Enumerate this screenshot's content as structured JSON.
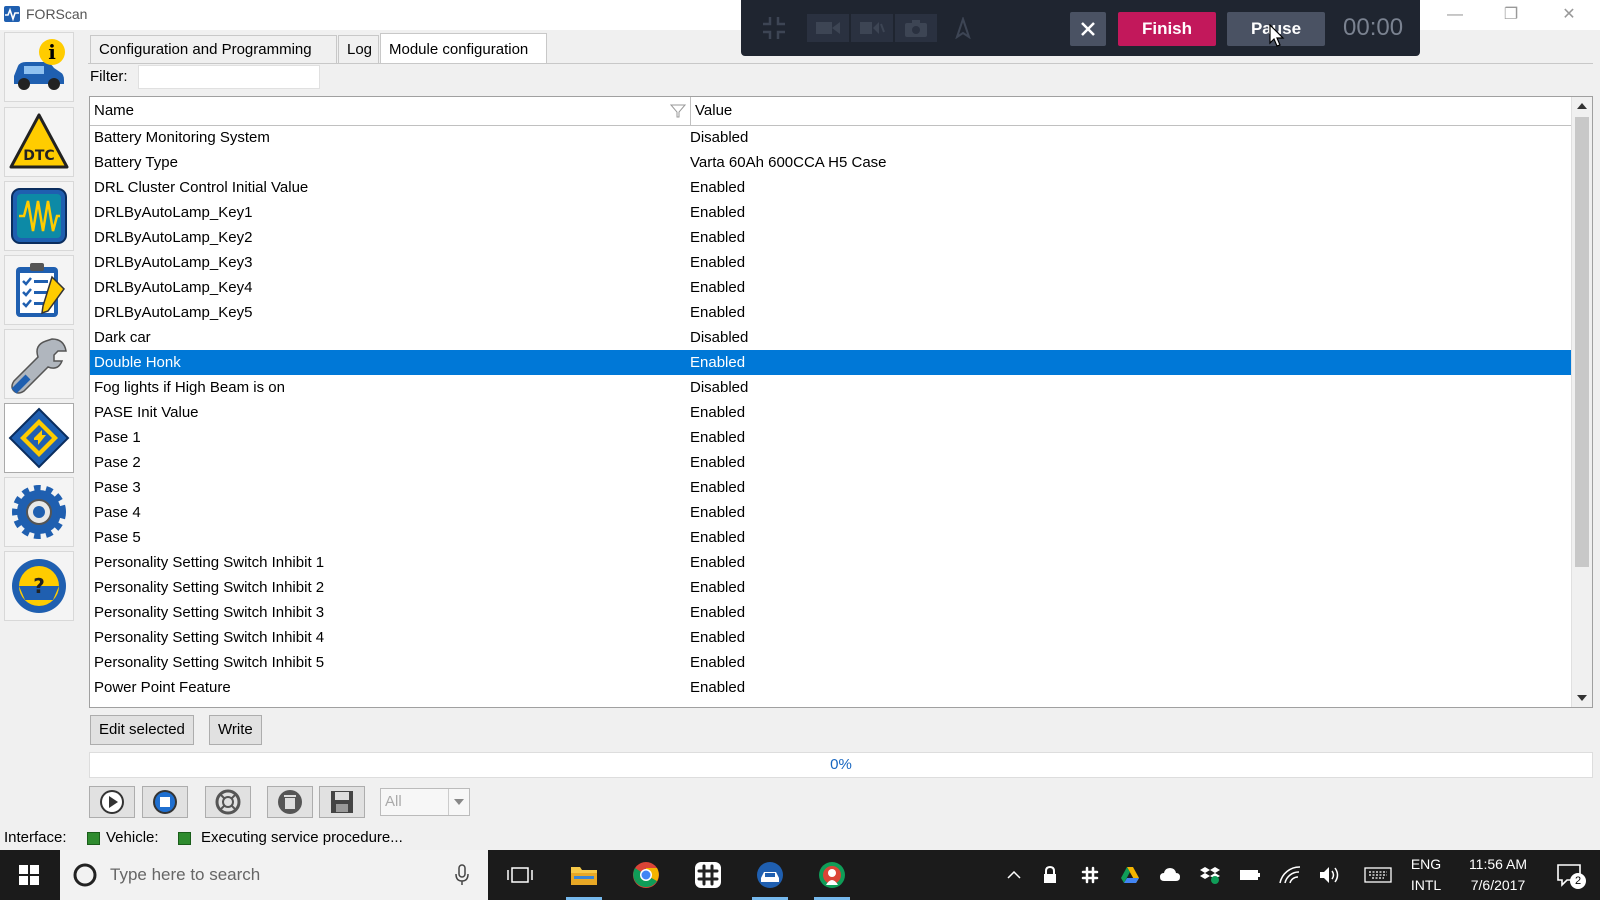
{
  "window": {
    "title": "FORScan"
  },
  "tabs": [
    {
      "label": "Configuration and Programming"
    },
    {
      "label": "Log"
    },
    {
      "label": "Module configuration"
    }
  ],
  "filter": {
    "label": "Filter:",
    "value": ""
  },
  "grid": {
    "columns": {
      "name": "Name",
      "value": "Value"
    },
    "rows": [
      {
        "name": "Battery Monitoring System",
        "value": "Disabled"
      },
      {
        "name": "Battery Type",
        "value": "Varta 60Ah 600CCA H5 Case"
      },
      {
        "name": "DRL Cluster Control Initial Value",
        "value": "Enabled"
      },
      {
        "name": "DRLByAutoLamp_Key1",
        "value": "Enabled"
      },
      {
        "name": "DRLByAutoLamp_Key2",
        "value": "Enabled"
      },
      {
        "name": "DRLByAutoLamp_Key3",
        "value": "Enabled"
      },
      {
        "name": "DRLByAutoLamp_Key4",
        "value": "Enabled"
      },
      {
        "name": "DRLByAutoLamp_Key5",
        "value": "Enabled"
      },
      {
        "name": "Dark car",
        "value": "Disabled"
      },
      {
        "name": "Double Honk",
        "value": "Enabled"
      },
      {
        "name": "Fog lights if High Beam is on",
        "value": "Disabled"
      },
      {
        "name": "PASE Init Value",
        "value": "Enabled"
      },
      {
        "name": "Pase 1",
        "value": "Enabled"
      },
      {
        "name": "Pase 2",
        "value": "Enabled"
      },
      {
        "name": "Pase 3",
        "value": "Enabled"
      },
      {
        "name": "Pase 4",
        "value": "Enabled"
      },
      {
        "name": "Pase 5",
        "value": "Enabled"
      },
      {
        "name": "Personality Setting Switch Inhibit 1",
        "value": "Enabled"
      },
      {
        "name": "Personality Setting Switch Inhibit 2",
        "value": "Enabled"
      },
      {
        "name": "Personality Setting Switch Inhibit 3",
        "value": "Enabled"
      },
      {
        "name": "Personality Setting Switch Inhibit 4",
        "value": "Enabled"
      },
      {
        "name": "Personality Setting Switch Inhibit 5",
        "value": "Enabled"
      },
      {
        "name": "Power Point Feature",
        "value": "Enabled"
      }
    ],
    "selected_row": "Double Honk"
  },
  "actions": {
    "edit_selected": "Edit selected",
    "write": "Write"
  },
  "progress": {
    "text": "0%",
    "value": 0
  },
  "toolbar": {
    "icons": [
      "play-icon",
      "stop-icon",
      "support-icon",
      "delete-icon",
      "save-icon"
    ],
    "combo_value": "All"
  },
  "statusbar": {
    "interface_label": "Interface:",
    "vehicle_label": "Vehicle:",
    "message": "Executing service procedure..."
  },
  "recorder": {
    "finish_label": "Finish",
    "pause_label": "Pause",
    "timer": "00:00"
  },
  "taskbar": {
    "search_placeholder": "Type here to search",
    "language_top": "ENG",
    "language_bottom": "INTL",
    "time": "11:56 AM",
    "date": "7/6/2017",
    "notification_count": "2"
  },
  "colors": {
    "selection": "#0078d7",
    "finish": "#c2185b",
    "pause": "#4a5263",
    "progress_text": "#1565c0",
    "led": "#2e8b2e"
  }
}
